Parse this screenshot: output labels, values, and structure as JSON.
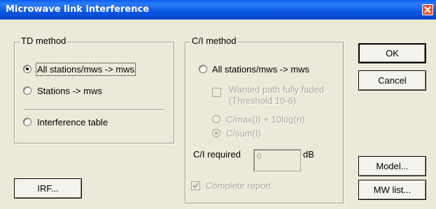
{
  "window": {
    "title": "Microwave link interference"
  },
  "td_method": {
    "legend": "TD method",
    "options": [
      {
        "label": "All stations/mws -> mws",
        "selected": true
      },
      {
        "label": "Stations -> mws",
        "selected": false
      },
      {
        "label": "Interference table",
        "selected": false
      }
    ]
  },
  "ci_method": {
    "legend": "C/I method",
    "all_stations_label": "All stations/mws -> mws",
    "wanted_path_label_line1": "Wanted path fully faded",
    "wanted_path_label_line2": "(Threshold 10-6)",
    "cmax_label": "C/max(I) + 10log(n)",
    "csum_label": "C/sum(I)",
    "ci_required_label": "C/I required",
    "ci_required_value": "0",
    "ci_required_unit": "dB",
    "complete_report_label": "Complete report"
  },
  "buttons": {
    "ok": "OK",
    "cancel": "Cancel",
    "irf": "IRF...",
    "model": "Model...",
    "mw_list": "MW list..."
  },
  "colors": {
    "title_bar": "#0a56e4",
    "dialog_bg": "#ece9d8",
    "close_button": "#e2562f",
    "disabled_text": "#a9a79c"
  }
}
